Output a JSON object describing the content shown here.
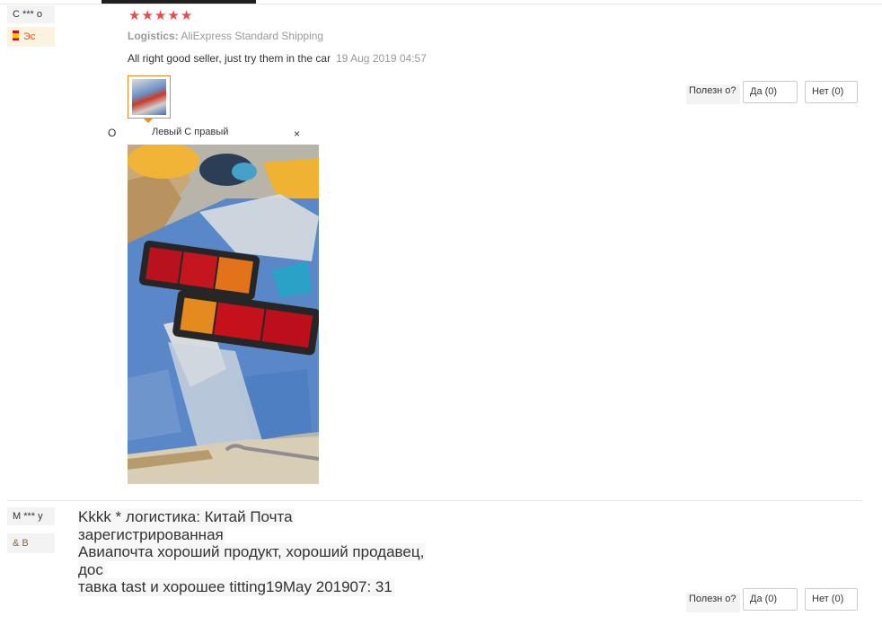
{
  "review1": {
    "user": "С *** о",
    "country": "Эс",
    "rating": 5,
    "logistics_label": "Logistics:",
    "logistics_value": "AliExpress Standard Shipping",
    "comment": "All right good seller, just try them in the car",
    "date": "19 Aug 2019 04:57",
    "image_letter": "О",
    "image_tab_label": "Левый С правый",
    "close_label": "×",
    "helpful_label": "Полезн о?",
    "yes_label": "Да (0)",
    "no_label": "Нет (0)"
  },
  "review2": {
    "user": "M *** у",
    "country": "& B",
    "lines": [
      "Kkkk * логистика: Китай Почта",
      "зарегистрированная",
      "Авиапочта хороший продукт, хороший продавец,",
      "дос",
      "тавка tast и хорошее titting19May 201907: 31"
    ],
    "helpful_label": "Полезн о?",
    "yes_label": "Да (0)",
    "no_label": "Нет (0)"
  },
  "colors": {
    "star": "#f0484a",
    "accent_orange": "#f08a24",
    "country_bg": "#fbf3e0"
  }
}
